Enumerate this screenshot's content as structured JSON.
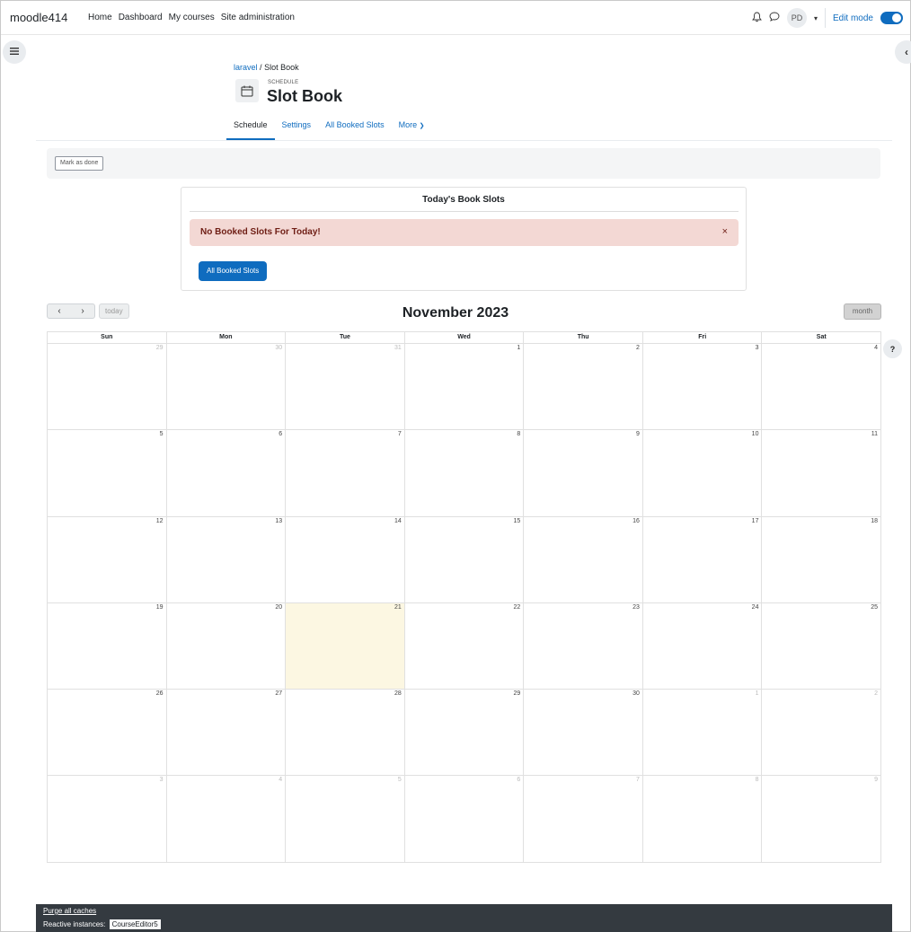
{
  "navbar": {
    "brand": "moodle414",
    "items": [
      "Home",
      "Dashboard",
      "My courses",
      "Site administration"
    ],
    "user_initials": "PD",
    "edit_mode_label": "Edit mode"
  },
  "header": {
    "breadcrumb_link": "laravel",
    "breadcrumb_sep": "/",
    "breadcrumb_current": "Slot Book",
    "module_kind": "SCHEDULE",
    "title": "Slot Book"
  },
  "secondary_nav": {
    "tabs": [
      "Schedule",
      "Settings",
      "All Booked Slots",
      "More"
    ]
  },
  "completion": {
    "mark_done_label": "Mark as done"
  },
  "today_panel": {
    "title": "Today's Book Slots",
    "alert": "No Booked Slots For Today!",
    "close": "×",
    "button": "All Booked Slots"
  },
  "calendar": {
    "title": "November 2023",
    "today_label": "today",
    "view_label": "month",
    "weekdays": [
      "Sun",
      "Mon",
      "Tue",
      "Wed",
      "Thu",
      "Fri",
      "Sat"
    ],
    "weeks": [
      [
        [
          "29",
          true
        ],
        [
          "30",
          true
        ],
        [
          "31",
          true
        ],
        [
          "1",
          false
        ],
        [
          "2",
          false
        ],
        [
          "3",
          false
        ],
        [
          "4",
          false
        ]
      ],
      [
        [
          "5",
          false
        ],
        [
          "6",
          false
        ],
        [
          "7",
          false
        ],
        [
          "8",
          false
        ],
        [
          "9",
          false
        ],
        [
          "10",
          false
        ],
        [
          "11",
          false
        ]
      ],
      [
        [
          "12",
          false
        ],
        [
          "13",
          false
        ],
        [
          "14",
          false
        ],
        [
          "15",
          false
        ],
        [
          "16",
          false
        ],
        [
          "17",
          false
        ],
        [
          "18",
          false
        ]
      ],
      [
        [
          "19",
          false
        ],
        [
          "20",
          false
        ],
        [
          "21",
          false
        ],
        [
          "22",
          false
        ],
        [
          "23",
          false
        ],
        [
          "24",
          false
        ],
        [
          "25",
          false
        ]
      ],
      [
        [
          "26",
          false
        ],
        [
          "27",
          false
        ],
        [
          "28",
          false
        ],
        [
          "29",
          false
        ],
        [
          "30",
          false
        ],
        [
          "1",
          true
        ],
        [
          "2",
          true
        ]
      ],
      [
        [
          "3",
          true
        ],
        [
          "4",
          true
        ],
        [
          "5",
          true
        ],
        [
          "6",
          true
        ],
        [
          "7",
          true
        ],
        [
          "8",
          true
        ],
        [
          "9",
          true
        ]
      ]
    ],
    "today_date": "21"
  },
  "help_label": "?",
  "footer": {
    "purge": "Purge all caches",
    "reactive_label": "Reactive instances:",
    "reactive_value": "CourseEditor5"
  },
  "colors": {
    "accent": "#0f6cbf",
    "today_bg": "#fcf7e2",
    "alert_bg": "#f3d8d4",
    "footer_bg": "#343a40"
  }
}
